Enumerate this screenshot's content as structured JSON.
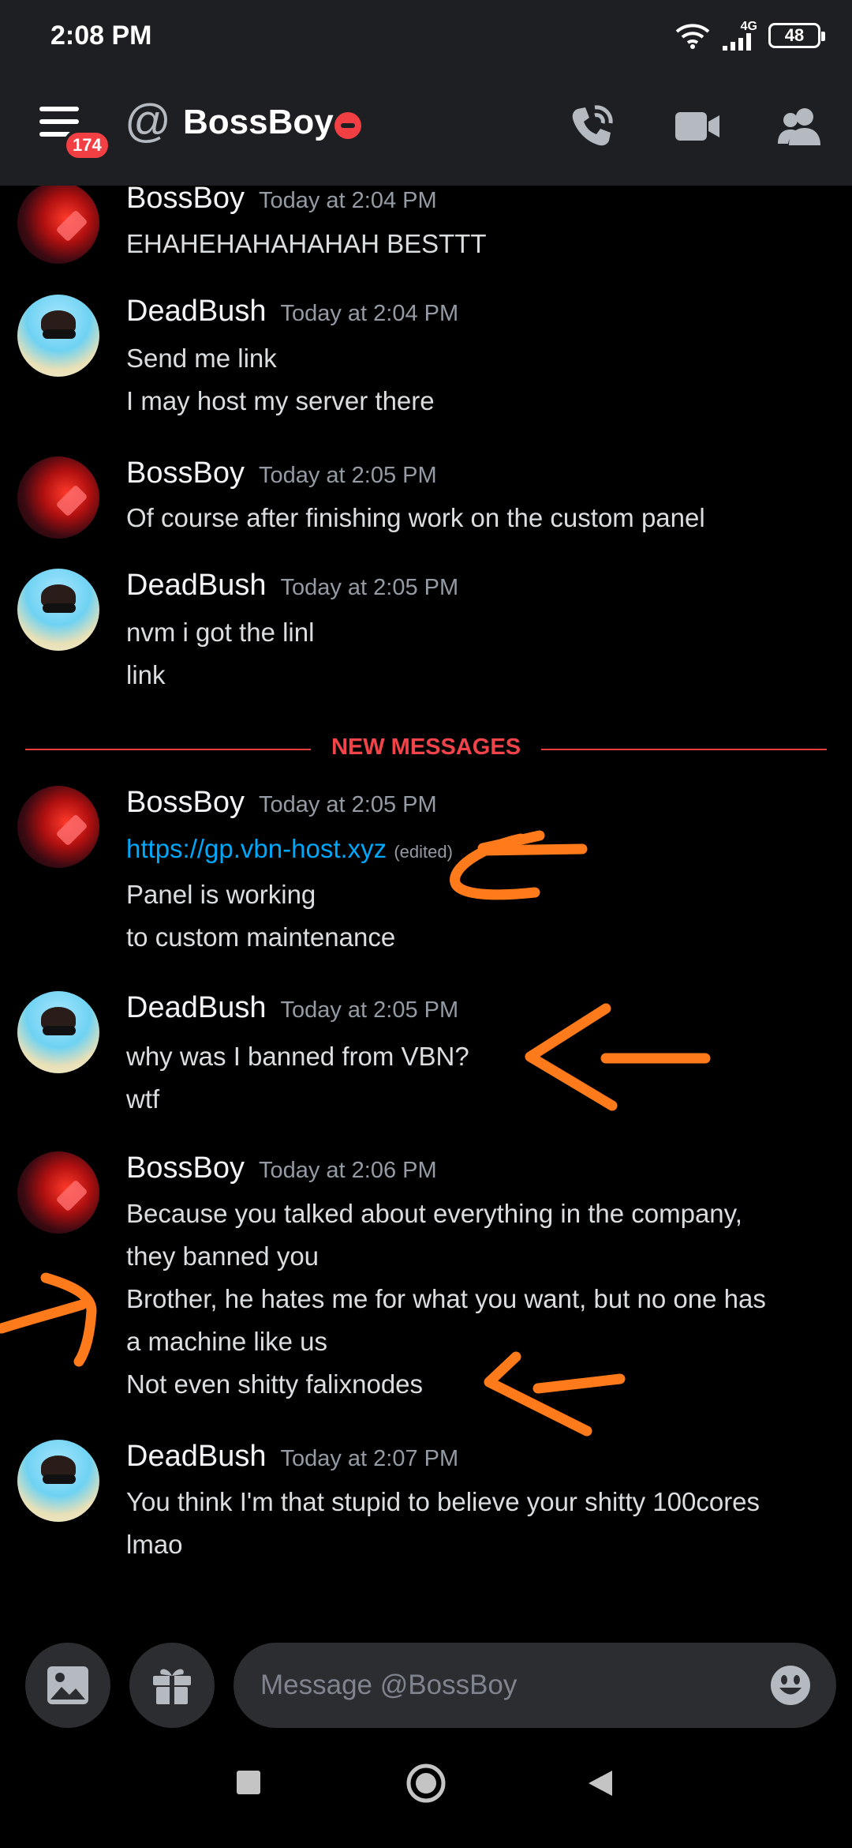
{
  "status_bar": {
    "time": "2:08 PM",
    "network": "4G",
    "battery": "48"
  },
  "header": {
    "unread_count": "174",
    "channel_name": "BossBoy"
  },
  "divider": {
    "label": "NEW MESSAGES"
  },
  "messages": [
    {
      "author": "BossBoy",
      "time": "Today at 2:04 PM",
      "lines": [
        "EHAHEHAHAHAHAH BESTTT"
      ]
    },
    {
      "author": "DeadBush",
      "time": "Today at 2:04 PM",
      "lines": [
        "Send me link",
        "I may host my server there"
      ]
    },
    {
      "author": "BossBoy",
      "time": "Today at 2:05 PM",
      "lines": [
        "Of course after finishing work on the custom panel"
      ]
    },
    {
      "author": "DeadBush",
      "time": "Today at 2:05 PM",
      "lines": [
        "nvm i got the linl",
        "link"
      ]
    },
    {
      "author": "BossBoy",
      "time": "Today at 2:05 PM",
      "link": "https://gp.vbn-host.xyz",
      "edited": "(edited)",
      "lines": [
        "Panel is working",
        "to custom maintenance"
      ]
    },
    {
      "author": "DeadBush",
      "time": "Today at 2:05 PM",
      "lines": [
        "why was I banned from VBN?",
        "wtf"
      ]
    },
    {
      "author": "BossBoy",
      "time": "Today at 2:06 PM",
      "lines": [
        "Because you talked about everything in the company,",
        "they banned you",
        "Brother, he hates me for what you want, but no one has",
        "a machine like us",
        "Not even shitty falixnodes"
      ]
    },
    {
      "author": "DeadBush",
      "time": "Today at 2:07 PM",
      "lines": [
        "You think I'm that stupid to believe your shitty 100cores",
        "lmao"
      ]
    }
  ],
  "composer": {
    "placeholder": "Message @BossBoy"
  },
  "icons": {
    "menu": "hamburger-menu-icon",
    "at": "at-sign-icon",
    "dnd": "do-not-disturb-icon",
    "call": "phone-call-icon",
    "video": "video-camera-icon",
    "members": "members-icon",
    "image": "image-icon",
    "gift": "gift-icon",
    "emoji": "emoji-icon",
    "nav_recents": "square-icon",
    "nav_home": "circle-icon",
    "nav_back": "triangle-back-icon"
  },
  "colors": {
    "background": "#000000",
    "header": "#1e1f22",
    "input": "#2b2d31",
    "link": "#00a8fc",
    "new_messages": "#f0444a",
    "annotation": "#ff7a1a"
  }
}
